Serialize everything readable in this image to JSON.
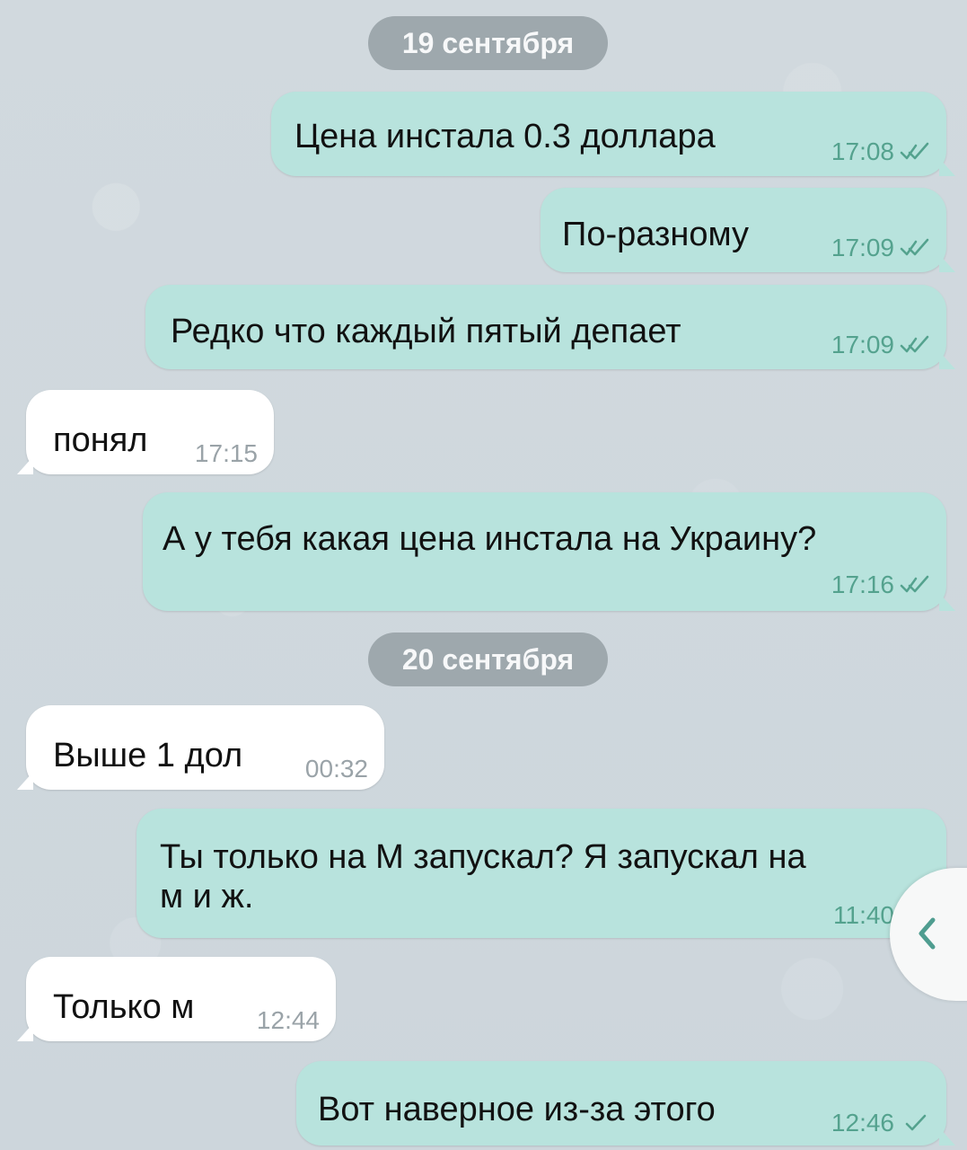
{
  "dates": {
    "sep19": "19 сентября",
    "sep20": "20 сентября"
  },
  "messages": [
    {
      "text": "Цена инстала 0.3 доллара",
      "time": "17:08",
      "status": "double-check-icon"
    },
    {
      "text": "По-разному",
      "time": "17:09",
      "status": "double-check-icon"
    },
    {
      "text": "Редко что каждый пятый депает",
      "time": "17:09",
      "status": "double-check-icon"
    },
    {
      "text": "понял",
      "time": "17:15"
    },
    {
      "text": "А у тебя какая цена инстала на Украину?",
      "time": "17:16",
      "status": "double-check-icon"
    },
    {
      "text": "Выше 1 дол",
      "time": "00:32"
    },
    {
      "text": "Ты только на М запускал? Я запускал на\nм и ж.",
      "time": "11:40",
      "status": "double-check-icon"
    },
    {
      "text": "Только м",
      "time": "12:44"
    },
    {
      "text": "Вот наверное из-за этого",
      "time": "12:46",
      "status": "check-icon"
    }
  ],
  "colors": {
    "background": "#cfd8de",
    "outgoing": "#b8e3dd",
    "incoming": "#ffffff",
    "date_pill": "#9ea8ad",
    "status": "#54a28e"
  }
}
